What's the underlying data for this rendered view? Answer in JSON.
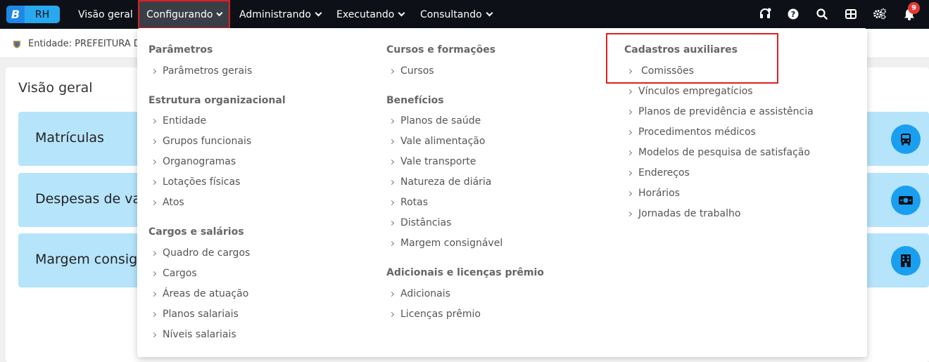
{
  "logo": {
    "letter": "B",
    "product": "RH"
  },
  "nav": [
    {
      "label": "Visão geral",
      "has_chevron": false
    },
    {
      "label": "Configurando",
      "has_chevron": true,
      "active": true
    },
    {
      "label": "Administrando",
      "has_chevron": true
    },
    {
      "label": "Executando",
      "has_chevron": true
    },
    {
      "label": "Consultando",
      "has_chevron": true
    }
  ],
  "top_icons": [
    "headset-icon",
    "help-icon",
    "search-icon",
    "apps-grid-icon",
    "settings-icon",
    "bell-icon"
  ],
  "notifications_count": "9",
  "entity": {
    "text": "Entidade: PREFEITURA D"
  },
  "main": {
    "title": "Visão geral",
    "tiles": [
      {
        "label": "Matrículas",
        "icon": "bus-icon"
      },
      {
        "label": "Despesas de va",
        "icon": "money-icon"
      },
      {
        "label": "Margem consig",
        "icon": "building-icon"
      }
    ]
  },
  "menu": {
    "columns": [
      {
        "sections": [
          {
            "title": "Parâmetros",
            "items": [
              "Parâmetros gerais"
            ]
          },
          {
            "title": "Estrutura organizacional",
            "items": [
              "Entidade",
              "Grupos funcionais",
              "Organogramas",
              "Lotações físicas",
              "Atos"
            ]
          },
          {
            "title": "Cargos e salários",
            "items": [
              "Quadro de cargos",
              "Cargos",
              "Áreas de atuação",
              "Planos salariais",
              "Níveis salariais"
            ]
          }
        ]
      },
      {
        "sections": [
          {
            "title": "Cursos e formações",
            "items": [
              "Cursos"
            ]
          },
          {
            "title": "Benefícios",
            "items": [
              "Planos de saúde",
              "Vale alimentação",
              "Vale transporte",
              "Natureza de diária",
              "Rotas",
              "Distâncias",
              "Margem consignável"
            ]
          },
          {
            "title": "Adicionais e licenças prêmio",
            "items": [
              "Adicionais",
              "Licenças prêmio"
            ]
          }
        ]
      },
      {
        "sections": [
          {
            "title": "Cadastros auxiliares",
            "items": [
              "Comissões",
              "Vínculos empregatícios",
              "Planos de previdência e assistência",
              "Procedimentos médicos",
              "Modelos de pesquisa de satisfação",
              "Endereços",
              "Horários",
              "Jornadas de trabalho"
            ]
          }
        ]
      }
    ]
  },
  "colors": {
    "topbar": "#0d1117",
    "accent": "#1a9ff0",
    "tile_bg": "#b6e4fb",
    "highlight": "#e02020",
    "badge": "#e53935"
  }
}
